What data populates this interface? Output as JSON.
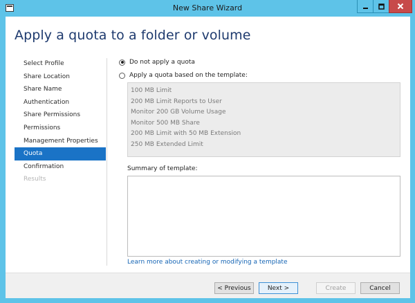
{
  "window": {
    "title": "New Share Wizard"
  },
  "page": {
    "title": "Apply a quota to a folder or volume"
  },
  "nav": {
    "items": [
      {
        "label": "Select Profile"
      },
      {
        "label": "Share Location"
      },
      {
        "label": "Share Name"
      },
      {
        "label": "Authentication"
      },
      {
        "label": "Share Permissions"
      },
      {
        "label": "Permissions"
      },
      {
        "label": "Management Properties"
      },
      {
        "label": "Quota"
      },
      {
        "label": "Confirmation"
      },
      {
        "label": "Results"
      }
    ],
    "active": "Quota",
    "disabled": "Results"
  },
  "quota": {
    "option_none": "Do not apply a quota",
    "option_template": "Apply a quota based on the template:",
    "selected": "Do not apply a quota",
    "templates": [
      "100 MB Limit",
      "200 MB Limit Reports to User",
      "Monitor 200 GB Volume Usage",
      "Monitor 500 MB Share",
      "200 MB Limit with 50 MB Extension",
      "250 MB Extended Limit"
    ],
    "summary_label": "Summary of template:",
    "summary_text": "",
    "learn_link": "Learn more about creating or modifying a template"
  },
  "footer": {
    "previous": "< Previous",
    "next": "Next >",
    "create": "Create",
    "cancel": "Cancel"
  },
  "colors": {
    "frame": "#5ec3e8",
    "close_button": "#c74a4a",
    "accent": "#1a73c6",
    "title_text": "#1e3a6e",
    "link": "#1464b4"
  }
}
